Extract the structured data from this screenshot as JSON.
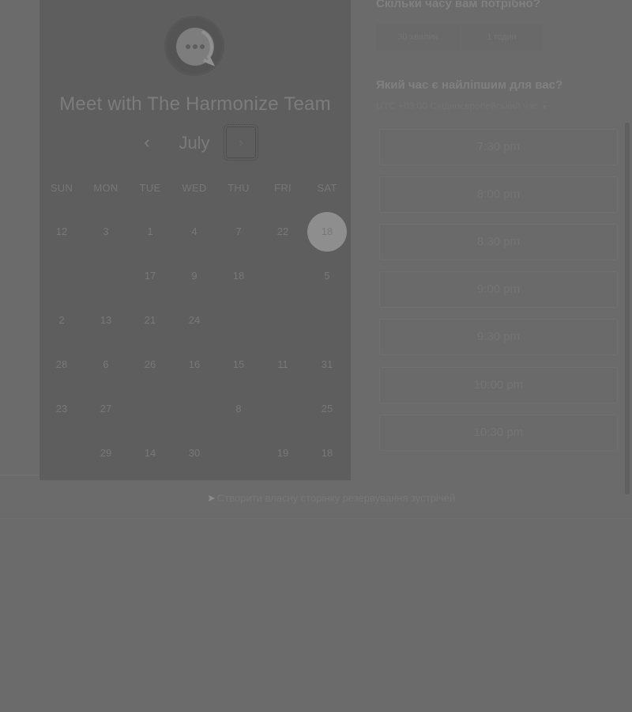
{
  "calendar": {
    "title": "Meet with The Harmonize Team",
    "month": "July",
    "prev_icon": "chevron-left-icon",
    "next_icon": "chevron-right-icon",
    "weekdays": [
      "SUN",
      "MON",
      "TUE",
      "WED",
      "THU",
      "FRI",
      "SAT"
    ],
    "weeks": [
      [
        "12",
        "3",
        "1",
        "4",
        "7",
        "22",
        "18"
      ],
      [
        "",
        "",
        "17",
        "9",
        "18",
        "",
        "5"
      ],
      [
        "2",
        "13",
        "21",
        "24",
        "",
        "",
        ""
      ],
      [
        "28",
        "6",
        "26",
        "16",
        "15",
        "11",
        "31"
      ],
      [
        "23",
        "27",
        "",
        "",
        "8",
        "",
        "25"
      ],
      [
        "",
        "29",
        "14",
        "30",
        "",
        "19",
        "18"
      ]
    ],
    "selected_day": "18"
  },
  "booking": {
    "duration_question": "Скільки часу вам потрібно?",
    "durations": [
      "30 хвилин",
      "1 годин"
    ],
    "time_question": "Який час є найліпшим для вас?",
    "timezone": "UTC +03:00 Східноєвропейський час",
    "slots": [
      "7:30 pm",
      "8:00 pm",
      "8:30 pm",
      "9:00 pm",
      "9:30 pm",
      "10:00 pm",
      "10:30 pm"
    ]
  },
  "footer": {
    "link": "Створити власну сторінку резервування зустрічей"
  }
}
